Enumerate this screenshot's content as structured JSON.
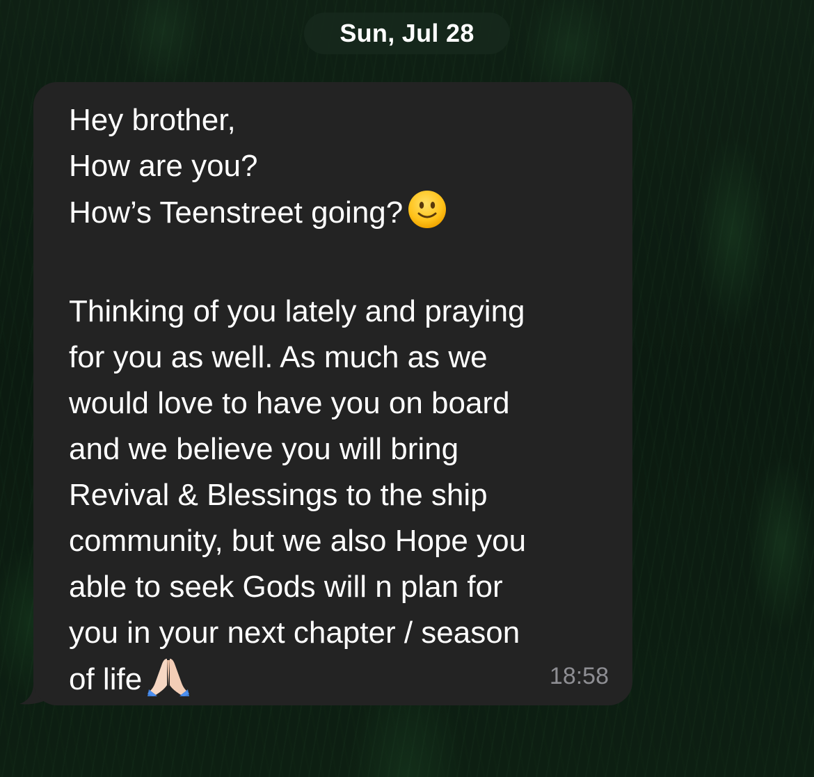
{
  "date_separator": "Sun, Jul 28",
  "message": {
    "line1": "Hey brother,",
    "line2": "How are you?",
    "line3": "How’s Teenstreet going?",
    "line3_emoji": "slightly-smiling-face-icon",
    "paragraph_lines": [
      "Thinking of you lately and praying",
      "for you as well. As much as we",
      "would love to have you on board",
      "and we believe you will bring",
      "Revival & Blessings to the ship",
      "community, but we also Hope you",
      "able to seek Gods will n plan for",
      "you in your next chapter / season"
    ],
    "last_line": "of life",
    "last_line_emoji": "folded-hands-icon",
    "time": "18:58"
  },
  "colors": {
    "bubble": "#232323",
    "pill": "#16281c",
    "timestamp": "#8e8e93"
  }
}
